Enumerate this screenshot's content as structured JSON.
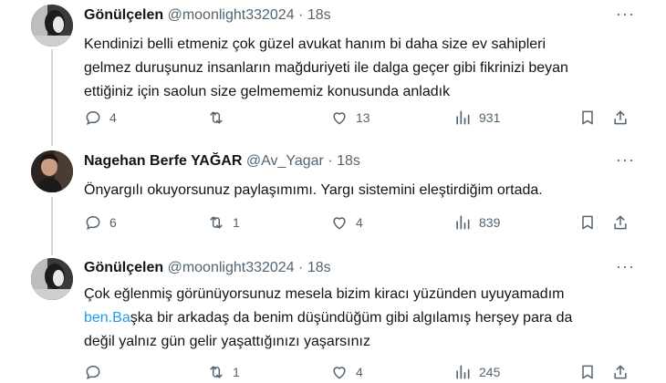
{
  "tweets": [
    {
      "name": "Gönülçelen",
      "handle": "@moonlight332024",
      "dot": "·",
      "time": "18s",
      "more": "···",
      "lines": [
        "Kendinizi belli etmeniz çok güzel avukat hanım bi daha size ev sahipleri",
        "gelmez duruşunuz insanların mağduriyeti ile dalga geçer gibi fikrinizi beyan",
        "ettiğiniz için saolun size gelmememiz konusunda anladık"
      ],
      "replies": "4",
      "retweets": "",
      "likes": "13",
      "views": "931"
    },
    {
      "name": "Nagehan Berfe YAĞAR",
      "handle": "@Av_Yagar",
      "dot": "·",
      "time": "18s",
      "more": "···",
      "lines": [
        "Önyargılı okuyorsunuz paylaşımımı. Yargı sistemini eleştirdiğim ortada."
      ],
      "replies": "6",
      "retweets": "1",
      "likes": "4",
      "views": "839"
    },
    {
      "name": "Gönülçelen",
      "handle": "@moonlight332024",
      "dot": "·",
      "time": "18s",
      "more": "···",
      "line1": "Çok eğlenmiş görünüyorsunuz mesela bizim kiracı yüzünden uyuyamadım",
      "line2_link": "ben.Ba",
      "line2_rest": "şka bir arkadaş da benim düşündüğüm gibi algılamış herşey para da",
      "line3": "değil yalnız gün gelir yaşattığınızı yaşarsınız",
      "replies": "",
      "retweets": "1",
      "likes": "4",
      "views": "245"
    }
  ],
  "colors": {
    "text": "#0f1419",
    "muted": "#536471",
    "link": "#1d9bf0",
    "thread": "#cfd9de"
  },
  "icons": [
    "reply-icon",
    "retweet-icon",
    "like-icon",
    "views-icon",
    "bookmark-icon",
    "share-icon",
    "more-icon"
  ]
}
